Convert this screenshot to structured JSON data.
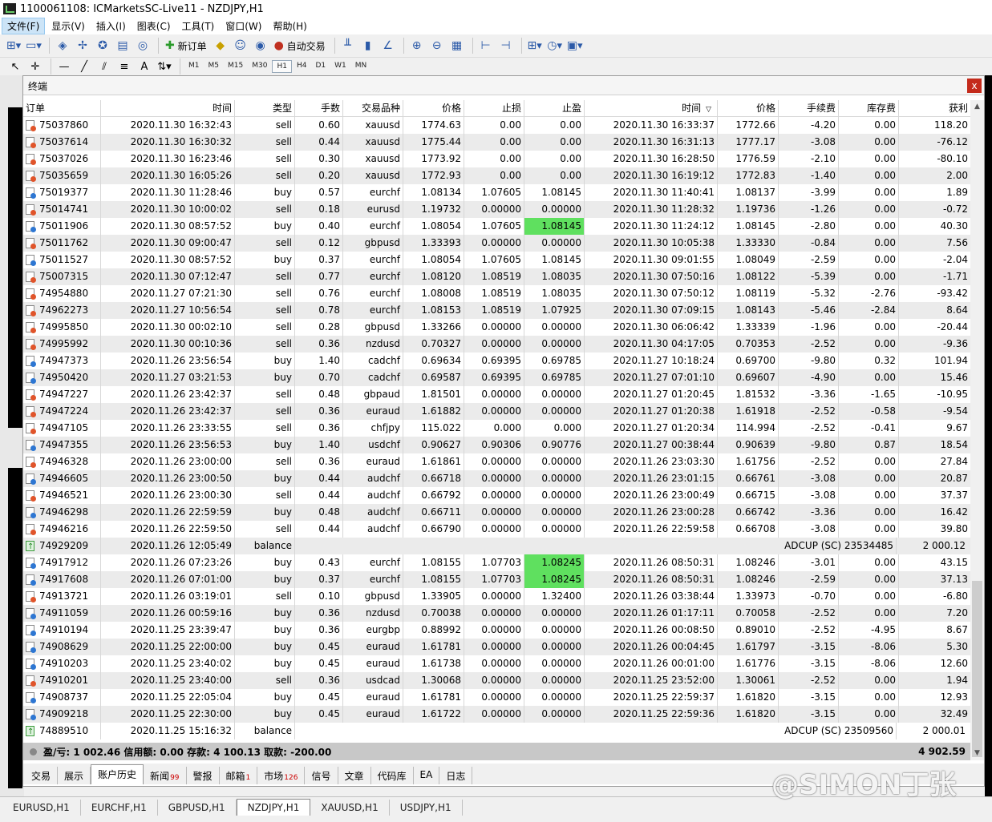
{
  "window": {
    "title": "1100061108: ICMarketsSC-Live11 - NZDJPY,H1"
  },
  "menu": [
    "文件(F)",
    "显示(V)",
    "插入(I)",
    "图表(C)",
    "工具(T)",
    "窗口(W)",
    "帮助(H)"
  ],
  "toolbar": {
    "new_order": "新订单",
    "auto_trade": "自动交易"
  },
  "timeframes": [
    "M1",
    "M5",
    "M15",
    "M30",
    "H1",
    "H4",
    "D1",
    "W1",
    "MN"
  ],
  "active_timeframe": "H1",
  "terminal": {
    "title": "终端",
    "close_label": "x",
    "columns": [
      "订单",
      "时间",
      "类型",
      "手数",
      "交易品种",
      "价格",
      "止损",
      "止盈",
      "时间",
      "价格",
      "手续费",
      "库存费",
      "获利"
    ],
    "sort_marker": "▽",
    "rows": [
      {
        "order": "75037860",
        "open_time": "2020.11.30 16:32:43",
        "type": "sell",
        "lots": "0.60",
        "symbol": "xauusd",
        "price": "1774.63",
        "sl": "0.00",
        "tp": "0.00",
        "close_time": "2020.11.30 16:33:37",
        "close_price": "1772.66",
        "commission": "-4.20",
        "swap": "0.00",
        "profit": "118.20"
      },
      {
        "order": "75037614",
        "open_time": "2020.11.30 16:30:32",
        "type": "sell",
        "lots": "0.44",
        "symbol": "xauusd",
        "price": "1775.44",
        "sl": "0.00",
        "tp": "0.00",
        "close_time": "2020.11.30 16:31:13",
        "close_price": "1777.17",
        "commission": "-3.08",
        "swap": "0.00",
        "profit": "-76.12"
      },
      {
        "order": "75037026",
        "open_time": "2020.11.30 16:23:46",
        "type": "sell",
        "lots": "0.30",
        "symbol": "xauusd",
        "price": "1773.92",
        "sl": "0.00",
        "tp": "0.00",
        "close_time": "2020.11.30 16:28:50",
        "close_price": "1776.59",
        "commission": "-2.10",
        "swap": "0.00",
        "profit": "-80.10"
      },
      {
        "order": "75035659",
        "open_time": "2020.11.30 16:05:26",
        "type": "sell",
        "lots": "0.20",
        "symbol": "xauusd",
        "price": "1772.93",
        "sl": "0.00",
        "tp": "0.00",
        "close_time": "2020.11.30 16:19:12",
        "close_price": "1772.83",
        "commission": "-1.40",
        "swap": "0.00",
        "profit": "2.00"
      },
      {
        "order": "75019377",
        "open_time": "2020.11.30 11:28:46",
        "type": "buy",
        "lots": "0.57",
        "symbol": "eurchf",
        "price": "1.08134",
        "sl": "1.07605",
        "tp": "1.08145",
        "close_time": "2020.11.30 11:40:41",
        "close_price": "1.08137",
        "commission": "-3.99",
        "swap": "0.00",
        "profit": "1.89"
      },
      {
        "order": "75014741",
        "open_time": "2020.11.30 10:00:02",
        "type": "sell",
        "lots": "0.18",
        "symbol": "eurusd",
        "price": "1.19732",
        "sl": "0.00000",
        "tp": "0.00000",
        "close_time": "2020.11.30 11:28:32",
        "close_price": "1.19736",
        "commission": "-1.26",
        "swap": "0.00",
        "profit": "-0.72"
      },
      {
        "order": "75011906",
        "open_time": "2020.11.30 08:57:52",
        "type": "buy",
        "lots": "0.40",
        "symbol": "eurchf",
        "price": "1.08054",
        "sl": "1.07605",
        "tp": "1.08145",
        "tp_hit": true,
        "close_time": "2020.11.30 11:24:12",
        "close_price": "1.08145",
        "commission": "-2.80",
        "swap": "0.00",
        "profit": "40.30"
      },
      {
        "order": "75011762",
        "open_time": "2020.11.30 09:00:47",
        "type": "sell",
        "lots": "0.12",
        "symbol": "gbpusd",
        "price": "1.33393",
        "sl": "0.00000",
        "tp": "0.00000",
        "close_time": "2020.11.30 10:05:38",
        "close_price": "1.33330",
        "commission": "-0.84",
        "swap": "0.00",
        "profit": "7.56"
      },
      {
        "order": "75011527",
        "open_time": "2020.11.30 08:57:52",
        "type": "buy",
        "lots": "0.37",
        "symbol": "eurchf",
        "price": "1.08054",
        "sl": "1.07605",
        "tp": "1.08145",
        "close_time": "2020.11.30 09:01:55",
        "close_price": "1.08049",
        "commission": "-2.59",
        "swap": "0.00",
        "profit": "-2.04"
      },
      {
        "order": "75007315",
        "open_time": "2020.11.30 07:12:47",
        "type": "sell",
        "lots": "0.77",
        "symbol": "eurchf",
        "price": "1.08120",
        "sl": "1.08519",
        "tp": "1.08035",
        "close_time": "2020.11.30 07:50:16",
        "close_price": "1.08122",
        "commission": "-5.39",
        "swap": "0.00",
        "profit": "-1.71"
      },
      {
        "order": "74954880",
        "open_time": "2020.11.27 07:21:30",
        "type": "sell",
        "lots": "0.76",
        "symbol": "eurchf",
        "price": "1.08008",
        "sl": "1.08519",
        "tp": "1.08035",
        "close_time": "2020.11.30 07:50:12",
        "close_price": "1.08119",
        "commission": "-5.32",
        "swap": "-2.76",
        "profit": "-93.42"
      },
      {
        "order": "74962273",
        "open_time": "2020.11.27 10:56:54",
        "type": "sell",
        "lots": "0.78",
        "symbol": "eurchf",
        "price": "1.08153",
        "sl": "1.08519",
        "tp": "1.07925",
        "close_time": "2020.11.30 07:09:15",
        "close_price": "1.08143",
        "commission": "-5.46",
        "swap": "-2.84",
        "profit": "8.64"
      },
      {
        "order": "74995850",
        "open_time": "2020.11.30 00:02:10",
        "type": "sell",
        "lots": "0.28",
        "symbol": "gbpusd",
        "price": "1.33266",
        "sl": "0.00000",
        "tp": "0.00000",
        "close_time": "2020.11.30 06:06:42",
        "close_price": "1.33339",
        "commission": "-1.96",
        "swap": "0.00",
        "profit": "-20.44"
      },
      {
        "order": "74995992",
        "open_time": "2020.11.30 00:10:36",
        "type": "sell",
        "lots": "0.36",
        "symbol": "nzdusd",
        "price": "0.70327",
        "sl": "0.00000",
        "tp": "0.00000",
        "close_time": "2020.11.30 04:17:05",
        "close_price": "0.70353",
        "commission": "-2.52",
        "swap": "0.00",
        "profit": "-9.36"
      },
      {
        "order": "74947373",
        "open_time": "2020.11.26 23:56:54",
        "type": "buy",
        "lots": "1.40",
        "symbol": "cadchf",
        "price": "0.69634",
        "sl": "0.69395",
        "tp": "0.69785",
        "close_time": "2020.11.27 10:18:24",
        "close_price": "0.69700",
        "commission": "-9.80",
        "swap": "0.32",
        "profit": "101.94"
      },
      {
        "order": "74950420",
        "open_time": "2020.11.27 03:21:53",
        "type": "buy",
        "lots": "0.70",
        "symbol": "cadchf",
        "price": "0.69587",
        "sl": "0.69395",
        "tp": "0.69785",
        "close_time": "2020.11.27 07:01:10",
        "close_price": "0.69607",
        "commission": "-4.90",
        "swap": "0.00",
        "profit": "15.46"
      },
      {
        "order": "74947227",
        "open_time": "2020.11.26 23:42:37",
        "type": "sell",
        "lots": "0.48",
        "symbol": "gbpaud",
        "price": "1.81501",
        "sl": "0.00000",
        "tp": "0.00000",
        "close_time": "2020.11.27 01:20:45",
        "close_price": "1.81532",
        "commission": "-3.36",
        "swap": "-1.65",
        "profit": "-10.95"
      },
      {
        "order": "74947224",
        "open_time": "2020.11.26 23:42:37",
        "type": "sell",
        "lots": "0.36",
        "symbol": "euraud",
        "price": "1.61882",
        "sl": "0.00000",
        "tp": "0.00000",
        "close_time": "2020.11.27 01:20:38",
        "close_price": "1.61918",
        "commission": "-2.52",
        "swap": "-0.58",
        "profit": "-9.54"
      },
      {
        "order": "74947105",
        "open_time": "2020.11.26 23:33:55",
        "type": "sell",
        "lots": "0.36",
        "symbol": "chfjpy",
        "price": "115.022",
        "sl": "0.000",
        "tp": "0.000",
        "close_time": "2020.11.27 01:20:34",
        "close_price": "114.994",
        "commission": "-2.52",
        "swap": "-0.41",
        "profit": "9.67"
      },
      {
        "order": "74947355",
        "open_time": "2020.11.26 23:56:53",
        "type": "buy",
        "lots": "1.40",
        "symbol": "usdchf",
        "price": "0.90627",
        "sl": "0.90306",
        "tp": "0.90776",
        "close_time": "2020.11.27 00:38:44",
        "close_price": "0.90639",
        "commission": "-9.80",
        "swap": "0.87",
        "profit": "18.54"
      },
      {
        "order": "74946328",
        "open_time": "2020.11.26 23:00:00",
        "type": "sell",
        "lots": "0.36",
        "symbol": "euraud",
        "price": "1.61861",
        "sl": "0.00000",
        "tp": "0.00000",
        "close_time": "2020.11.26 23:03:30",
        "close_price": "1.61756",
        "commission": "-2.52",
        "swap": "0.00",
        "profit": "27.84"
      },
      {
        "order": "74946605",
        "open_time": "2020.11.26 23:00:50",
        "type": "buy",
        "lots": "0.44",
        "symbol": "audchf",
        "price": "0.66718",
        "sl": "0.00000",
        "tp": "0.00000",
        "close_time": "2020.11.26 23:01:15",
        "close_price": "0.66761",
        "commission": "-3.08",
        "swap": "0.00",
        "profit": "20.87"
      },
      {
        "order": "74946521",
        "open_time": "2020.11.26 23:00:30",
        "type": "sell",
        "lots": "0.44",
        "symbol": "audchf",
        "price": "0.66792",
        "sl": "0.00000",
        "tp": "0.00000",
        "close_time": "2020.11.26 23:00:49",
        "close_price": "0.66715",
        "commission": "-3.08",
        "swap": "0.00",
        "profit": "37.37"
      },
      {
        "order": "74946298",
        "open_time": "2020.11.26 22:59:59",
        "type": "buy",
        "lots": "0.48",
        "symbol": "audchf",
        "price": "0.66711",
        "sl": "0.00000",
        "tp": "0.00000",
        "close_time": "2020.11.26 23:00:28",
        "close_price": "0.66742",
        "commission": "-3.36",
        "swap": "0.00",
        "profit": "16.42"
      },
      {
        "order": "74946216",
        "open_time": "2020.11.26 22:59:50",
        "type": "sell",
        "lots": "0.44",
        "symbol": "audchf",
        "price": "0.66790",
        "sl": "0.00000",
        "tp": "0.00000",
        "close_time": "2020.11.26 22:59:58",
        "close_price": "0.66708",
        "commission": "-3.08",
        "swap": "0.00",
        "profit": "39.80"
      },
      {
        "order": "74929209",
        "open_time": "2020.11.26 12:05:49",
        "type": "balance",
        "comment": "ADCUP (SC) 23534485",
        "profit": "2 000.12"
      },
      {
        "order": "74917912",
        "open_time": "2020.11.26 07:23:26",
        "type": "buy",
        "lots": "0.43",
        "symbol": "eurchf",
        "price": "1.08155",
        "sl": "1.07703",
        "tp": "1.08245",
        "tp_hit": true,
        "close_time": "2020.11.26 08:50:31",
        "close_price": "1.08246",
        "commission": "-3.01",
        "swap": "0.00",
        "profit": "43.15"
      },
      {
        "order": "74917608",
        "open_time": "2020.11.26 07:01:00",
        "type": "buy",
        "lots": "0.37",
        "symbol": "eurchf",
        "price": "1.08155",
        "sl": "1.07703",
        "tp": "1.08245",
        "tp_hit": true,
        "close_time": "2020.11.26 08:50:31",
        "close_price": "1.08246",
        "commission": "-2.59",
        "swap": "0.00",
        "profit": "37.13"
      },
      {
        "order": "74913721",
        "open_time": "2020.11.26 03:19:01",
        "type": "sell",
        "lots": "0.10",
        "symbol": "gbpusd",
        "price": "1.33905",
        "sl": "0.00000",
        "tp": "1.32400",
        "close_time": "2020.11.26 03:38:44",
        "close_price": "1.33973",
        "commission": "-0.70",
        "swap": "0.00",
        "profit": "-6.80"
      },
      {
        "order": "74911059",
        "open_time": "2020.11.26 00:59:16",
        "type": "buy",
        "lots": "0.36",
        "symbol": "nzdusd",
        "price": "0.70038",
        "sl": "0.00000",
        "tp": "0.00000",
        "close_time": "2020.11.26 01:17:11",
        "close_price": "0.70058",
        "commission": "-2.52",
        "swap": "0.00",
        "profit": "7.20"
      },
      {
        "order": "74910194",
        "open_time": "2020.11.25 23:39:47",
        "type": "buy",
        "lots": "0.36",
        "symbol": "eurgbp",
        "price": "0.88992",
        "sl": "0.00000",
        "tp": "0.00000",
        "close_time": "2020.11.26 00:08:50",
        "close_price": "0.89010",
        "commission": "-2.52",
        "swap": "-4.95",
        "profit": "8.67"
      },
      {
        "order": "74908629",
        "open_time": "2020.11.25 22:00:00",
        "type": "buy",
        "lots": "0.45",
        "symbol": "euraud",
        "price": "1.61781",
        "sl": "0.00000",
        "tp": "0.00000",
        "close_time": "2020.11.26 00:04:45",
        "close_price": "1.61797",
        "commission": "-3.15",
        "swap": "-8.06",
        "profit": "5.30"
      },
      {
        "order": "74910203",
        "open_time": "2020.11.25 23:40:02",
        "type": "buy",
        "lots": "0.45",
        "symbol": "euraud",
        "price": "1.61738",
        "sl": "0.00000",
        "tp": "0.00000",
        "close_time": "2020.11.26 00:01:00",
        "close_price": "1.61776",
        "commission": "-3.15",
        "swap": "-8.06",
        "profit": "12.60"
      },
      {
        "order": "74910201",
        "open_time": "2020.11.25 23:40:00",
        "type": "sell",
        "lots": "0.36",
        "symbol": "usdcad",
        "price": "1.30068",
        "sl": "0.00000",
        "tp": "0.00000",
        "close_time": "2020.11.25 23:52:00",
        "close_price": "1.30061",
        "commission": "-2.52",
        "swap": "0.00",
        "profit": "1.94"
      },
      {
        "order": "74908737",
        "open_time": "2020.11.25 22:05:04",
        "type": "buy",
        "lots": "0.45",
        "symbol": "euraud",
        "price": "1.61781",
        "sl": "0.00000",
        "tp": "0.00000",
        "close_time": "2020.11.25 22:59:37",
        "close_price": "1.61820",
        "commission": "-3.15",
        "swap": "0.00",
        "profit": "12.93"
      },
      {
        "order": "74909218",
        "open_time": "2020.11.25 22:30:00",
        "type": "buy",
        "lots": "0.45",
        "symbol": "euraud",
        "price": "1.61722",
        "sl": "0.00000",
        "tp": "0.00000",
        "close_time": "2020.11.25 22:59:36",
        "close_price": "1.61820",
        "commission": "-3.15",
        "swap": "0.00",
        "profit": "32.49"
      },
      {
        "order": "74889510",
        "open_time": "2020.11.25 15:16:32",
        "type": "balance",
        "comment": "ADCUP (SC) 23509560",
        "profit": "2 000.01"
      }
    ],
    "summary": {
      "text": "盈/亏: 1 002.46  信用额: 0.00  存款: 4 100.13  取款: -200.00",
      "total": "4 902.59"
    },
    "tabs": [
      {
        "label": "交易"
      },
      {
        "label": "展示"
      },
      {
        "label": "账户历史",
        "active": true
      },
      {
        "label": "新闻",
        "badge": "99"
      },
      {
        "label": "警报"
      },
      {
        "label": "邮箱",
        "badge": "1"
      },
      {
        "label": "市场",
        "badge": "126"
      },
      {
        "label": "信号"
      },
      {
        "label": "文章"
      },
      {
        "label": "代码库"
      },
      {
        "label": "EA"
      },
      {
        "label": "日志"
      }
    ]
  },
  "chart_tabs": [
    {
      "label": "EURUSD,H1"
    },
    {
      "label": "EURCHF,H1"
    },
    {
      "label": "GBPUSD,H1"
    },
    {
      "label": "NZDJPY,H1",
      "active": true
    },
    {
      "label": "XAUUSD,H1"
    },
    {
      "label": "USDJPY,H1"
    }
  ],
  "watermark": "@SIMON丁张"
}
